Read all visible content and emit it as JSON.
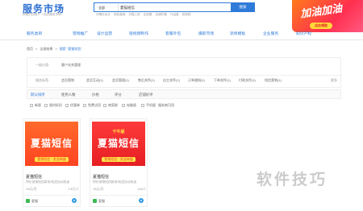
{
  "header": {
    "logo": "服务市场",
    "logo_sub": "阿里巴巴旗下 一站式服务市场",
    "search_category": "全部",
    "search_value": "夏猫短信",
    "search_button": "搜索",
    "hot_links": [
      "详情页设计",
      "短信营销",
      "天猫入驻",
      "应收跟",
      "店铺托管",
      "代运营",
      "短视频"
    ]
  },
  "promo": {
    "text": "加油加油",
    "button": "点击领取"
  },
  "nav": [
    "服务类目",
    "营销推广",
    "设计运营",
    "短视频制作",
    "客服外包",
    "摄影市场",
    "装修模板",
    "企业服务",
    "知识产权"
  ],
  "breadcrumb": {
    "home": "首页",
    "sep1": ">",
    "all": "全部结果",
    "sep2": ">",
    "search": "搜索 \"夏猫短信\""
  },
  "filters": {
    "row1": {
      "label": "一级分类:",
      "value": "客户关系管理"
    },
    "row2": {
      "label": "服务标签:",
      "values": [
        "会员营销",
        "会员互动(1)",
        "会员管理(1)",
        "售后关怀(1)",
        "自主关怀(1)",
        "订单通知(1)",
        "下单关怀(1)",
        "付款关怀(1)",
        "短信营销(1)"
      ],
      "more": "更多"
    }
  },
  "sort": [
    "默认排序",
    "使用人数",
    "价格",
    "评分",
    "店铺好评"
  ],
  "checks": [
    "新版",
    "限时折扣",
    "优惠券",
    "免费试用",
    "商家群",
    "电脑版",
    "手机版",
    "服务商可用"
  ],
  "cards": [
    {
      "img_main": "夏猫短信",
      "img_sub": "营销短信 · 发送神器",
      "img_foot": "",
      "img_top": "",
      "title": "夏猫短信",
      "desc": "特价营销短信群发/短信自动发送",
      "price": "15元/月",
      "users": "2.6万人",
      "vendor": "夏猫"
    },
    {
      "img_main": "夏猫短信",
      "img_sub": "营销短信 · 发送神器",
      "img_foot": "",
      "img_top": "千牛版",
      "title": "夏猫短信",
      "desc": "特价营销短信群发/短信自动发送",
      "price": "15元/月",
      "users": "144人",
      "vendor": "夏猫"
    }
  ],
  "watermark": "软件技巧",
  "colors": {
    "accent": "#2f7bd9",
    "promo": "#ff2f4f",
    "card1": "#ff5a26",
    "card2": "#e8242a"
  }
}
